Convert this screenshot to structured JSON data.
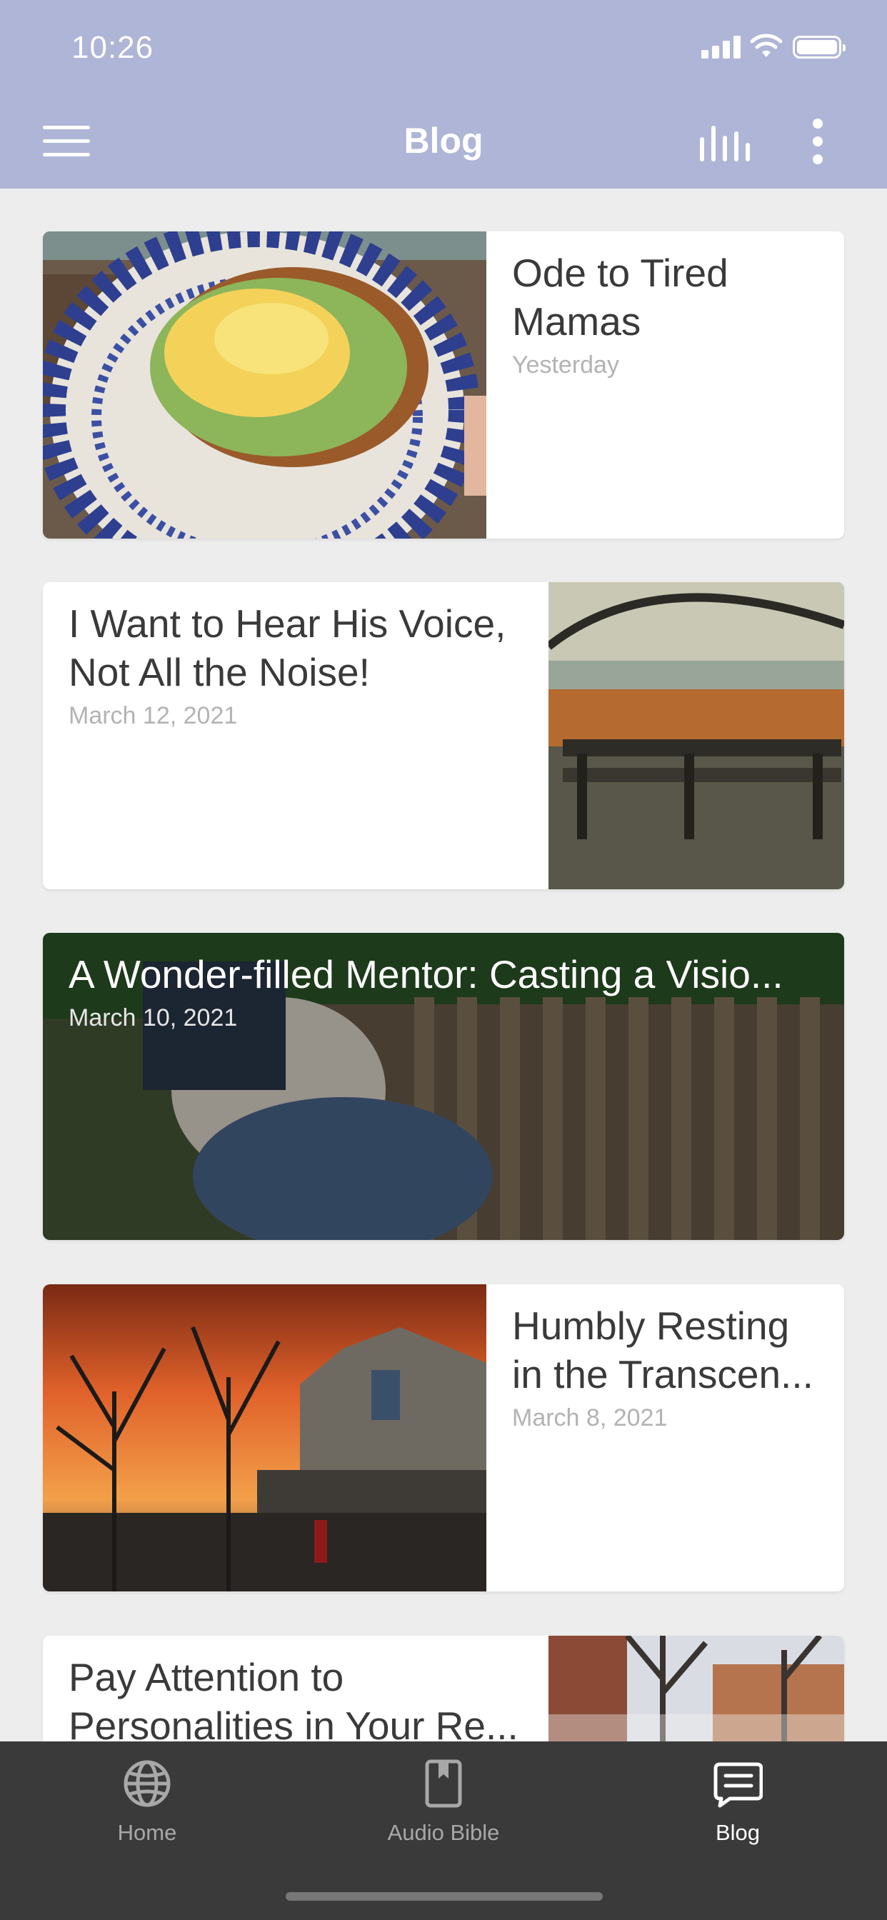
{
  "status_bar": {
    "time": "10:26"
  },
  "header": {
    "title": "Blog"
  },
  "posts": [
    {
      "title": "Ode to Tired Mamas",
      "date": "Yesterday",
      "image": "avocado-toast-eggs-plate"
    },
    {
      "title": "I Want to Hear His Voice, Not All the Noise!",
      "date": "March 12, 2021",
      "image": "park-bench-pond"
    },
    {
      "title": "A Wonder-filled Mentor: Casting a Visio...",
      "date": "March 10, 2021",
      "image": "woman-reading-on-bench"
    },
    {
      "title": "Humbly Resting in the Transcen...",
      "date": "March 8, 2021",
      "image": "sunset-church-trees"
    },
    {
      "title": "Pay Attention to Personalities in Your Re...",
      "date": "",
      "image": "snowy-street-trees"
    }
  ],
  "tabbar": {
    "tabs": [
      {
        "label": "Home",
        "icon": "globe-icon",
        "active": false
      },
      {
        "label": "Audio Bible",
        "icon": "book-icon",
        "active": false
      },
      {
        "label": "Blog",
        "icon": "blog-icon",
        "active": true
      }
    ]
  },
  "colors": {
    "header": "#aeb5d6",
    "background": "#ededed",
    "tabbar": "#3a3a3b"
  }
}
